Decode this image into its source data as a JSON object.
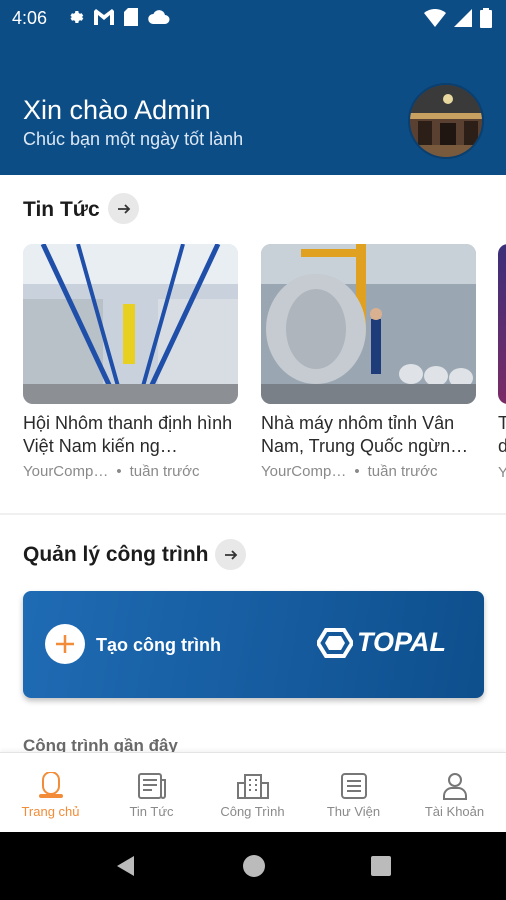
{
  "status_bar": {
    "time": "4:06"
  },
  "header": {
    "greeting": "Xin chào Admin",
    "subgreeting": "Chúc bạn một ngày tốt lành"
  },
  "news": {
    "title": "Tin Tức",
    "articles": [
      {
        "title": "Hội Nhôm thanh định hình Việt Nam kiến ng…",
        "source": "YourComp…",
        "time": "tuần trước"
      },
      {
        "title": "Nhà máy nhôm tỉnh Vân Nam, Trung Quốc ngừn…",
        "source": "YourComp…",
        "time": "tuần trước"
      }
    ],
    "partial_article_title": "T\nd",
    "partial_article_source": "Y"
  },
  "projects": {
    "title": "Quản lý công trình",
    "create_label": "Tạo công trình",
    "brand": "TOPAL",
    "recent_label": "Công trình gần đây"
  },
  "bottom_nav": {
    "items": [
      {
        "label": "Trang chủ",
        "icon": "home-icon",
        "active": true
      },
      {
        "label": "Tin Tức",
        "icon": "newspaper-icon",
        "active": false
      },
      {
        "label": "Công Trình",
        "icon": "building-icon",
        "active": false
      },
      {
        "label": "Thư Viện",
        "icon": "library-icon",
        "active": false
      },
      {
        "label": "Tài Khoản",
        "icon": "account-icon",
        "active": false
      }
    ]
  },
  "colors": {
    "header_bg": "#0d4d86",
    "accent": "#f28c38",
    "card_bg": "#1f6bb4"
  }
}
